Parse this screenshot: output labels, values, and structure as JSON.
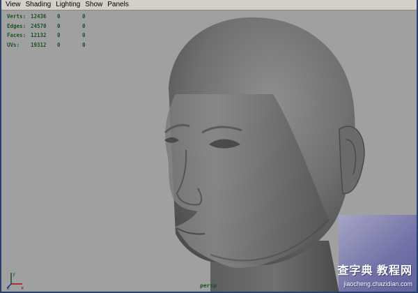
{
  "menu": {
    "items": [
      {
        "label": "View"
      },
      {
        "label": "Shading"
      },
      {
        "label": "Lighting"
      },
      {
        "label": "Show"
      },
      {
        "label": "Panels"
      }
    ]
  },
  "hud": {
    "rows": [
      {
        "label": "Verts:",
        "total": "12436",
        "selected": "0",
        "other": "0"
      },
      {
        "label": "Edges:",
        "total": "24570",
        "selected": "0",
        "other": "0"
      },
      {
        "label": "Faces:",
        "total": "12132",
        "selected": "0",
        "other": "0"
      },
      {
        "label": "UVs:",
        "total": "19312",
        "selected": "0",
        "other": "0"
      }
    ]
  },
  "camera_label": "persp",
  "axis": {
    "x": "x",
    "y": "y",
    "z": "z"
  },
  "watermark": {
    "text": "查字典 教程网",
    "url": "jiaocheng.chazidian.com"
  },
  "colors": {
    "viewport_bg": "#a0a0a0",
    "hud_text": "#1a5221",
    "menubar_bg": "#d4d0c8",
    "frame": "#28406f"
  },
  "icons": {
    "axis_gizmo": "xyz-axis-icon"
  }
}
